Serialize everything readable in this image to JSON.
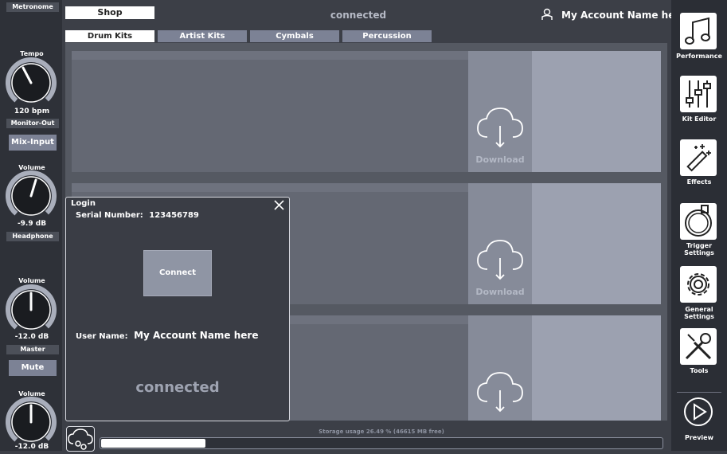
{
  "left_panel": {
    "metronome": {
      "header": "Metronome",
      "tempo_label": "Tempo",
      "tempo_value": "120 bpm"
    },
    "monitor_out": {
      "header": "Monitor-Out",
      "button": "Mix-Input",
      "volume_label": "Volume",
      "volume_value": "-9.9 dB"
    },
    "headphone": {
      "header": "Headphone",
      "volume_label": "Volume",
      "volume_value": "-12.0 dB"
    },
    "master": {
      "header": "Master",
      "button": "Mute",
      "volume_label": "Volume",
      "volume_value": "-12.0 dB"
    }
  },
  "header": {
    "shop_tab": "Shop",
    "status": "connected",
    "account_name": "My Account Name here"
  },
  "category_tabs": [
    {
      "label": "Drum Kits",
      "active": true
    },
    {
      "label": "Artist Kits",
      "active": false
    },
    {
      "label": "Cymbals",
      "active": false
    },
    {
      "label": "Percussion",
      "active": false
    }
  ],
  "cards": [
    {
      "action": "Download"
    },
    {
      "action": "Download"
    },
    {
      "action": ""
    }
  ],
  "login": {
    "title": "Login",
    "serial_label": "Serial Number:",
    "serial_value": "123456789",
    "connect_button": "Connect",
    "username_label": "User Name:",
    "username_value": "My Account Name here",
    "status": "connected"
  },
  "storage": {
    "text": "Storage usage 26.49 % (46615 MB free)",
    "usage_fraction": 0.2649
  },
  "right_sidebar": [
    {
      "label": "Performance",
      "icon": "music-note-icon"
    },
    {
      "label": "Kit Editor",
      "icon": "mixer-sliders-icon"
    },
    {
      "label": "Effects",
      "icon": "magic-wand-icon"
    },
    {
      "label": "Trigger Settings",
      "icon": "drum-icon"
    },
    {
      "label": "General Settings",
      "icon": "gear-icon"
    },
    {
      "label": "Tools",
      "icon": "tools-icon"
    },
    {
      "label": "Preview",
      "icon": "play-icon"
    }
  ]
}
